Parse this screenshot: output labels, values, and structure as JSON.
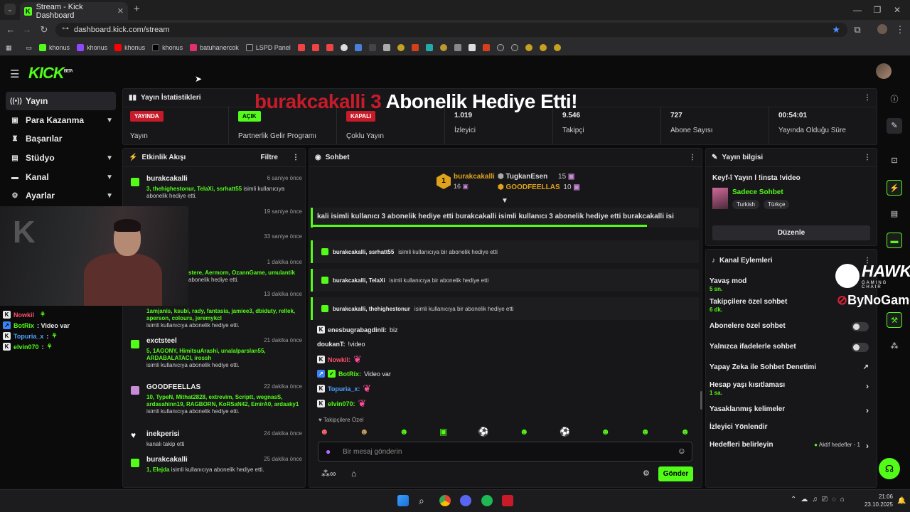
{
  "browser": {
    "tab_title": "Stream - Kick Dashboard",
    "url": "dashboard.kick.com/stream",
    "bookmarks": [
      "khonus",
      "khonus",
      "khonus",
      "khonus",
      "batuhanercok",
      "LSPD Panel"
    ]
  },
  "header": {
    "logo": "KICK",
    "logo_badge": "BETA"
  },
  "sidebar": {
    "items": [
      {
        "label": "Yayın",
        "icon": "broadcast-icon"
      },
      {
        "label": "Para Kazanma",
        "icon": "wallet-icon"
      },
      {
        "label": "Başarılar",
        "icon": "trophy-icon"
      },
      {
        "label": "Stüdyo",
        "icon": "studio-icon"
      },
      {
        "label": "Kanal",
        "icon": "channel-icon"
      },
      {
        "label": "Ayarlar",
        "icon": "gear-icon"
      }
    ]
  },
  "banner": {
    "user": "burakcakalli 3",
    "text": "Abonelik Hediye Etti!"
  },
  "stats": {
    "title": "Yayın İstatistikleri",
    "cols": [
      {
        "badge": "YAYINDA",
        "badge_color": "#c81b2a",
        "label": "Yayın"
      },
      {
        "badge": "AÇIK",
        "badge_color": "#53fc18",
        "label": "Partnerlik Gelir Programı"
      },
      {
        "badge": "KAPALI",
        "badge_color": "#c81b2a",
        "label": "Çoklu Yayın"
      },
      {
        "value": "1.019",
        "label": "İzleyici"
      },
      {
        "value": "9.546",
        "label": "Takipçi"
      },
      {
        "value": "727",
        "label": "Abone Sayısı"
      },
      {
        "value": "00:54:01",
        "label": "Yayında Olduğu Süre"
      }
    ]
  },
  "events": {
    "title": "Etkinlik Akışı",
    "filter": "Filtre",
    "items": [
      {
        "name": "burakcakalli",
        "time": "6 saniye önce",
        "names": "3, thehighestonur, TelaXi, ssrhatt55",
        "desc": "isimli kullanıcıya abonelik hediye etti."
      },
      {
        "name": "",
        "time": "19 saniye önce",
        "names": "",
        "desc": ""
      },
      {
        "name": "",
        "time": "33 saniye önce",
        "names": "",
        "desc": ""
      },
      {
        "name": "",
        "time": "1 dakika önce",
        "names": "stere, Aermorn, OzannGame, umulantik",
        "desc": "abonelik hediye etti."
      },
      {
        "name": "",
        "time": "13 dakika önce",
        "names": "1amjanis, ksubi, rady, fantasia, jamiee3, dbiduty, rellek, aperson, colours, jeremykcl",
        "desc": "isimli kullanıcıya abonelik hediye etti."
      },
      {
        "name": "exctsteel",
        "time": "21 dakika önce",
        "names": "5, 1AGONY, HimitsuArashi, unalalparslan55, ARDABALATACI, irossh",
        "desc": "isimli kullanıcıya abonelik hediye etti."
      },
      {
        "name": "GOODFEELLAS",
        "time": "22 dakika önce",
        "names": "10, TypeN, Mithat2828, extrevim, Scriptt, wegnasS, ardasahinn19, RAGBORN, KoRSaN42, EmirA0, ardaaky1",
        "desc": "isimli kullanıcıya abonelik hediye etti."
      },
      {
        "name": "inekperisi",
        "time": "24 dakika önce",
        "names": "",
        "desc": "kanalı takip etti"
      },
      {
        "name": "burakcakalli",
        "time": "25 dakika önce",
        "names": "1, Elejda",
        "desc": "isimli kullanıcıya abonelik hediye etti."
      }
    ]
  },
  "chat": {
    "title": "Sohbet",
    "leaders": [
      {
        "name": "burakcakalli",
        "count": "16"
      },
      {
        "name": "TugkanEsen",
        "count": "15"
      },
      {
        "name": "GOODFEELLAS",
        "count": "10"
      }
    ],
    "ticker": "kali isimli kullanıcı 3 abonelik hediye etti   burakcakalli isimli kullanıcı 3 abonelik hediye etti   burakcakalli isi",
    "gifts": [
      {
        "user": "burakcakalli, ssrhatt55",
        "text": "isimli kullanıcıya bir abonelik hediye etti"
      },
      {
        "user": "burakcakalli, TelaXi",
        "text": "isimli kullanıcıya bir abonelik hediye etti"
      },
      {
        "user": "burakcakalli, thehighestonur",
        "text": "isimli kullanıcıya bir abonelik hediye etti"
      }
    ],
    "messages": [
      {
        "user": "enesbugrabagdinli:",
        "text": "biz",
        "color": "#e9e9ea"
      },
      {
        "user": "doukanT:",
        "text": "!video",
        "color": "#e9e9ea"
      },
      {
        "user": "Nowkil:",
        "text": "",
        "color": "#ff4f6a"
      },
      {
        "user": "BotRix:",
        "text": "Video var",
        "color": "#53fc18"
      },
      {
        "user": "Topuria_x:",
        "text": "",
        "color": "#4fa3ff"
      },
      {
        "user": "elvin070:",
        "text": "",
        "color": "#53fc18"
      }
    ],
    "followers_only": "Takipçilere Özel",
    "placeholder": "Bir mesaj gönderin",
    "send": "Gönder"
  },
  "cam_chat": [
    {
      "user": "Nowkil",
      "text": "",
      "color": "#ff4f6a"
    },
    {
      "user": "BotRix",
      "text": ": Video var",
      "color": "#53fc18"
    },
    {
      "user": "Topuria_x",
      "text": ":",
      "color": "#4fa3ff"
    },
    {
      "user": "elvin070",
      "text": ":",
      "color": "#53fc18"
    }
  ],
  "info": {
    "title": "Yayın bilgisi",
    "stream_title": "Keyf-î Yayın l !insta !video",
    "category": "Sadece Sohbet",
    "tags": [
      "Turkish",
      "Türkçe"
    ],
    "edit": "Düzenle"
  },
  "actions": {
    "title": "Kanal Eylemleri",
    "items": [
      {
        "label": "Yavaş mod",
        "sub": "5 sn."
      },
      {
        "label": "Takipçilere özel sohbet",
        "sub": "6 dk."
      },
      {
        "label": "Abonelere özel sohbet",
        "sub": ""
      },
      {
        "label": "Yalnızca ifadelerle sohbet",
        "sub": ""
      },
      {
        "label": "Yapay Zeka ile Sohbet Denetimi",
        "sub": ""
      },
      {
        "label": "Hesap yaşı kısıtlaması",
        "sub": "1 sa."
      },
      {
        "label": "Yasaklanmış kelimeler",
        "sub": ""
      },
      {
        "label": "İzleyici Yönlendir",
        "sub": ""
      },
      {
        "label": "Hedefleri belirleyin",
        "sub": ""
      }
    ],
    "goal_status": "Aktif hedefler - 1"
  },
  "sponsors": {
    "hawk": "HAWK",
    "hawk_sub": "GAMING CHAIR",
    "bynogame": "ByNoGame"
  },
  "taskbar": {
    "time": "21:06",
    "date": "23.10.2025"
  }
}
